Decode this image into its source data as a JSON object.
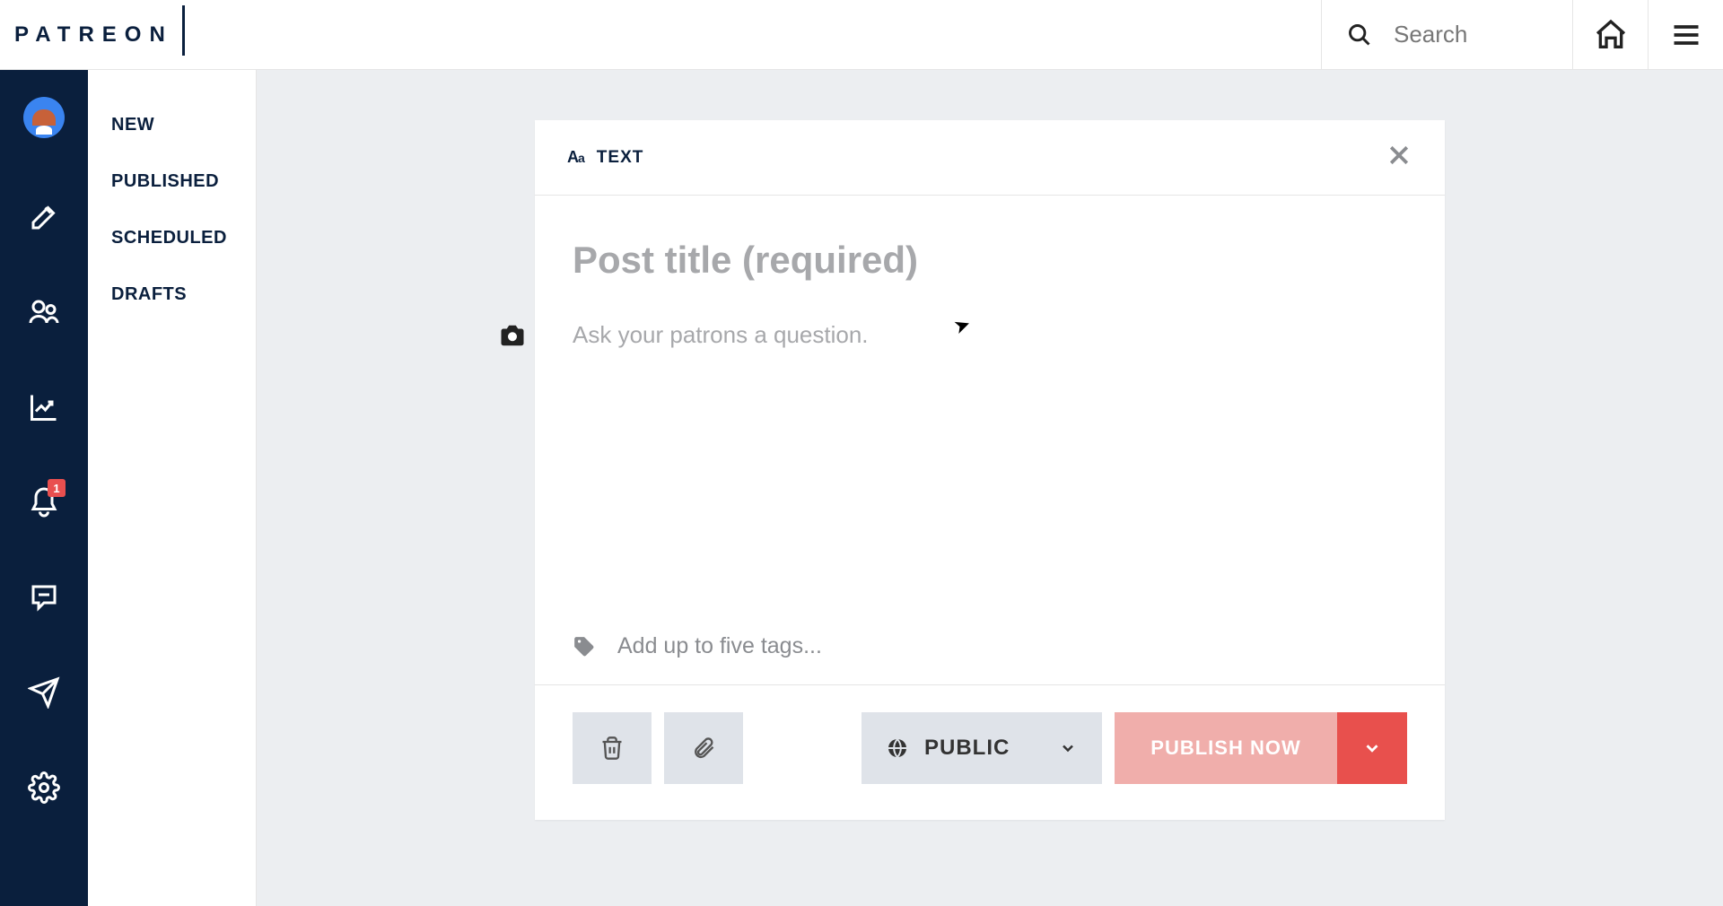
{
  "brand": "PATREON",
  "header": {
    "search_placeholder": "Search"
  },
  "rail": {
    "notification_badge": "1"
  },
  "subnav": {
    "items": [
      "NEW",
      "PUBLISHED",
      "SCHEDULED",
      "DRAFTS"
    ]
  },
  "editor": {
    "type_icon": "Aa",
    "type_label": "TEXT",
    "title_placeholder": "Post title (required)",
    "body_placeholder": "Ask your patrons a question.",
    "tags_placeholder": "Add up to five tags...",
    "visibility": "PUBLIC",
    "publish_label": "PUBLISH NOW"
  }
}
